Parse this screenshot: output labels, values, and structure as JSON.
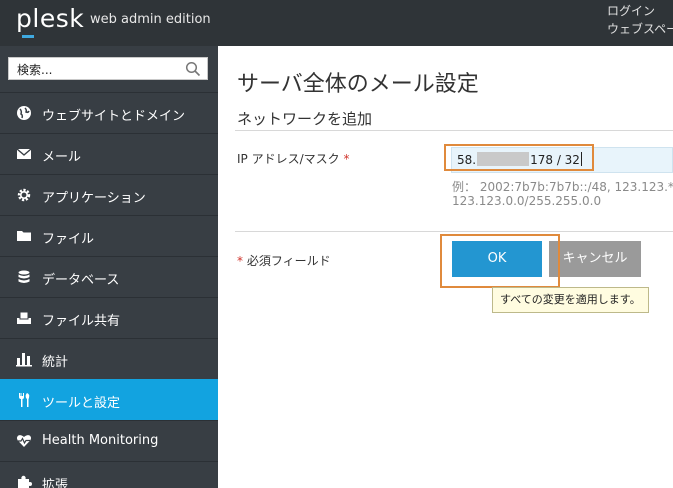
{
  "header": {
    "logo": "plesk",
    "edition": "web admin edition",
    "top_right_line1": "ログイン",
    "top_right_line2": "ウェブスペー"
  },
  "sidebar": {
    "search_placeholder": "検索...",
    "items": [
      {
        "label": "ウェブサイトとドメイン",
        "icon": "globe-icon"
      },
      {
        "label": "メール",
        "icon": "mail-icon"
      },
      {
        "label": "アプリケーション",
        "icon": "gear-icon"
      },
      {
        "label": "ファイル",
        "icon": "folder-icon"
      },
      {
        "label": "データベース",
        "icon": "database-icon"
      },
      {
        "label": "ファイル共有",
        "icon": "file-share-icon"
      },
      {
        "label": "統計",
        "icon": "bar-chart-icon"
      },
      {
        "label": "ツールと設定",
        "icon": "tools-icon",
        "active": true
      },
      {
        "label": "Health Monitoring",
        "icon": "heart-monitor-icon"
      },
      {
        "label": "拡張",
        "icon": "puzzle-icon"
      }
    ]
  },
  "main": {
    "title": "サーバ全体のメール設定",
    "section": "ネットワークを追加",
    "ip_label": "IP アドレス/マスク",
    "required_mark": "*",
    "ip_value_prefix": "58.",
    "ip_value_suffix": "178 / 32",
    "hint_line1": "例： 2002:7b7b:7b7b::/48, 123.123.*",
    "hint_line2": "123.123.0.0/255.255.0.0",
    "required_fields": "必須フィールド",
    "ok_label": "OK",
    "cancel_label": "キャンセル",
    "tooltip": "すべての変更を適用します。"
  },
  "colors": {
    "topbar": "#2f3438",
    "sidebar": "#383e44",
    "active_item": "#12a3e0",
    "ok_button": "#2396d1",
    "cancel_button": "#9a9a9a",
    "highlight": "#e08a3c"
  }
}
